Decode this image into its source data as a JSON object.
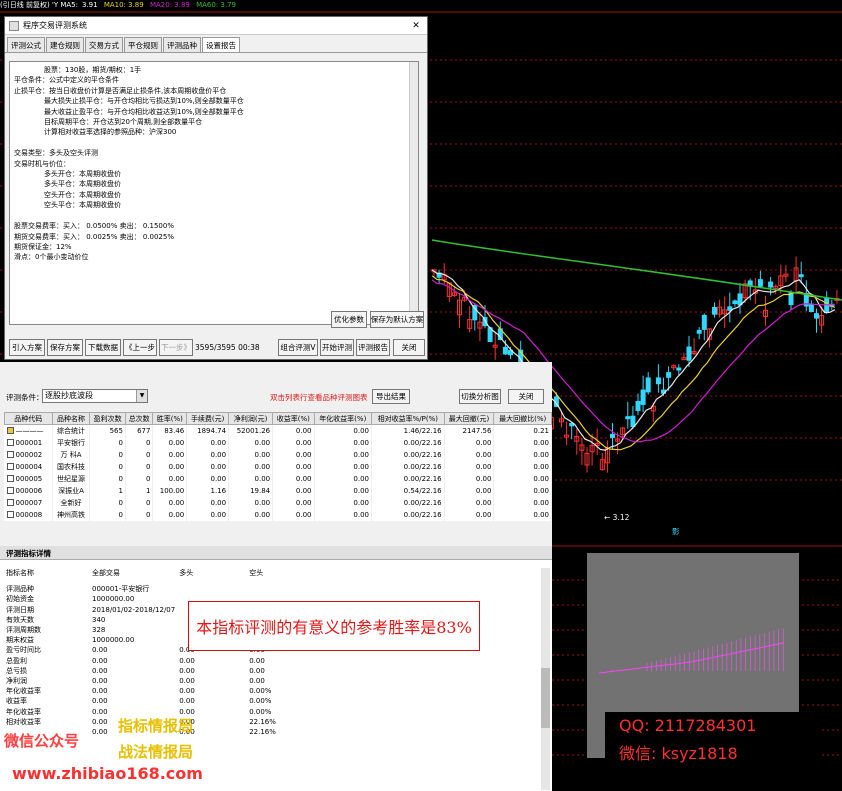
{
  "ma_bar": {
    "prefix": "(引日线 前复权) 'Y MA5:",
    "ma5": "3.91",
    "ma10": "MA10: 3.89",
    "ma20": "MA20: 3.89",
    "ma60": "MA60: 3.79"
  },
  "chart": {
    "low_label": "← 3.12",
    "marker": "影"
  },
  "colors": {
    "bull": "#ff3030",
    "bear": "#30d8ff",
    "ma5": "#e8e8e8",
    "ma10": "#e8d030",
    "ma20": "#d020d0",
    "ma60": "#30c030",
    "accent_red": "#e01818",
    "accent_green": "#20e020"
  },
  "eval_window": {
    "title": "程序交易评测系统",
    "close": "✕",
    "tabs": [
      "评测公式",
      "建仓规则",
      "交易方式",
      "平仓规则",
      "评测品种",
      "设置报告"
    ],
    "lines": [
      {
        "t": "股票：130股，期货/期权：1手",
        "ind": true
      },
      {
        "t": "平仓条件：公式中定义的平仓条件",
        "ind": false
      },
      {
        "t": "止损平仓：按当日收盘价计算是否满足止损条件,该本周期收盘价平仓",
        "ind": false
      },
      {
        "t": "最大损失止损平仓：与开仓均相比亏损达到10%,则全部数量平仓",
        "ind": true
      },
      {
        "t": "最大收益止盈平仓：与开仓均相比收益达到10%,则全部数量平仓",
        "ind": true
      },
      {
        "t": "目标周期平仓：开仓达到20个周期,则全部数量平仓",
        "ind": true
      },
      {
        "t": "计算相对收益率选择的参照品种：沪深300",
        "ind": true
      },
      {
        "t": "",
        "ind": false
      },
      {
        "t": "交易类型：多头及空头评测",
        "ind": false
      },
      {
        "t": "交易时机与价位：",
        "ind": false
      },
      {
        "t": "多头开仓：本周期收盘价",
        "ind": true
      },
      {
        "t": "多头平仓：本周期收盘价",
        "ind": true
      },
      {
        "t": "空头开仓：本周期收盘价",
        "ind": true
      },
      {
        "t": "空头平仓：本周期收盘价",
        "ind": true
      },
      {
        "t": "",
        "ind": false
      },
      {
        "t": "股票交易费率：买入： 0.0500%   卖出： 0.1500%",
        "ind": false
      },
      {
        "t": "期货交易费率：买入： 0.0025%   卖出： 0.0025%",
        "ind": false
      },
      {
        "t": "期货保证金：12%",
        "ind": false
      },
      {
        "t": "滑点：0个最小变动价位",
        "ind": false
      }
    ],
    "optimize": "优化参数",
    "save_default": "保存为默认方案",
    "import": "引入方案",
    "save": "保存方案",
    "download": "下载数据",
    "prev": "《上一步",
    "next": "下一步》",
    "progress": "3595/3595 00:38",
    "combo": "组合评测V",
    "start": "开始评测",
    "report": "评测报告",
    "close_btn": "关闭"
  },
  "result_window": {
    "condition_label": "评测条件：",
    "condition_value": "逐股抄底波段",
    "hint": "双击列表行查看品种评测图表",
    "export": "导出结果",
    "switch": "切换分析图",
    "close": "关闭",
    "headers": [
      "品种代码",
      "品种名称",
      "盈利次数",
      "总次数",
      "胜率(%)",
      "手续费(元)",
      "净利润(元)",
      "收益率(%)",
      "年化收益率(%)",
      "相对收益率%/P(%)",
      "最大回撤(元)",
      "最大回撤比(%)"
    ],
    "rows": [
      {
        "code": "————",
        "name": "综合统计",
        "win": "565",
        "total": "677",
        "rate": "83.46",
        "fee": "1894.74",
        "profit": "52001.26",
        "ret": "0.00",
        "ann": "0.00",
        "rel": "1.46/22.16",
        "dd": "2147.56",
        "ddr": "0.21",
        "sum": true
      },
      {
        "code": "000001",
        "name": "平安银行",
        "win": "0",
        "total": "0",
        "rate": "0.00",
        "fee": "0.00",
        "profit": "0.00",
        "ret": "0.00",
        "ann": "0.00",
        "rel": "0.00/22.16",
        "dd": "0.00",
        "ddr": "0.00",
        "sum": false
      },
      {
        "code": "000002",
        "name": "万 科A",
        "win": "0",
        "total": "0",
        "rate": "0.00",
        "fee": "0.00",
        "profit": "0.00",
        "ret": "0.00",
        "ann": "0.00",
        "rel": "0.00/22.16",
        "dd": "0.00",
        "ddr": "0.00",
        "sum": false
      },
      {
        "code": "000004",
        "name": "国农科技",
        "win": "0",
        "total": "0",
        "rate": "0.00",
        "fee": "0.00",
        "profit": "0.00",
        "ret": "0.00",
        "ann": "0.00",
        "rel": "0.00/22.16",
        "dd": "0.00",
        "ddr": "0.00",
        "sum": false
      },
      {
        "code": "000005",
        "name": "世纪星源",
        "win": "0",
        "total": "0",
        "rate": "0.00",
        "fee": "0.00",
        "profit": "0.00",
        "ret": "0.00",
        "ann": "0.00",
        "rel": "0.00/22.16",
        "dd": "0.00",
        "ddr": "0.00",
        "sum": false
      },
      {
        "code": "000006",
        "name": "深振业A",
        "win": "1",
        "total": "1",
        "rate": "100.00",
        "fee": "1.16",
        "profit": "19.84",
        "ret": "0.00",
        "ann": "0.00",
        "rel": "0.54/22.16",
        "dd": "0.00",
        "ddr": "0.00",
        "sum": false
      },
      {
        "code": "000007",
        "name": "全新好",
        "win": "0",
        "total": "0",
        "rate": "0.00",
        "fee": "0.00",
        "profit": "0.00",
        "ret": "0.00",
        "ann": "0.00",
        "rel": "0.00/22.16",
        "dd": "0.00",
        "ddr": "0.00",
        "sum": false
      },
      {
        "code": "000008",
        "name": "神州高铁",
        "win": "0",
        "total": "0",
        "rate": "0.00",
        "fee": "0.00",
        "profit": "0.00",
        "ret": "0.00",
        "ann": "0.00",
        "rel": "0.00/22.16",
        "dd": "0.00",
        "ddr": "0.00",
        "sum": false
      }
    ]
  },
  "detail": {
    "title": "评测指标详情",
    "cols": [
      "指标名称",
      "全部交易",
      "多头",
      "空头"
    ],
    "rows": [
      [
        "评测品种",
        "000001-平安银行",
        "",
        ""
      ],
      [
        "初始资金",
        "1000000.00",
        "",
        ""
      ],
      [
        "评测日期",
        "2018/01/02-2018/12/07",
        "",
        ""
      ],
      [
        "有效天数",
        "340",
        "",
        ""
      ],
      [
        "评测周期数",
        "328",
        "",
        ""
      ],
      [
        "期末权益",
        "1000000.00",
        "",
        ""
      ],
      [
        "盈亏时间比",
        "0.00",
        "0.00",
        "0.00"
      ],
      [
        "总盈利",
        "0.00",
        "0.00",
        "0.00"
      ],
      [
        "总亏损",
        "0.00",
        "0.00",
        "0.00"
      ],
      [
        "净利润",
        "0.00",
        "0.00",
        "0.00"
      ],
      [
        "年化收益率",
        "0.00",
        "0.00",
        "0.00%"
      ],
      [
        "收益率",
        "0.00",
        "0.00",
        "0.00%"
      ],
      [
        "年化收益率",
        "0.00",
        "0.00",
        "0.00%"
      ],
      [
        "相对收益率",
        "0.00",
        "0.00",
        "22.16%"
      ],
      [
        "",
        "0.00",
        "0.00",
        "22.16%"
      ]
    ]
  },
  "callout": "本指标评测的有意义的参考胜率是83%",
  "watermarks": {
    "wechat_label": "微信公众号",
    "wechat_name1": "指标情报局",
    "wechat_name2": "战法情报局",
    "site": "www.zhibiao168.com",
    "qq": "QQ: 2117284301",
    "weixin": "微信: ksyz1818"
  }
}
